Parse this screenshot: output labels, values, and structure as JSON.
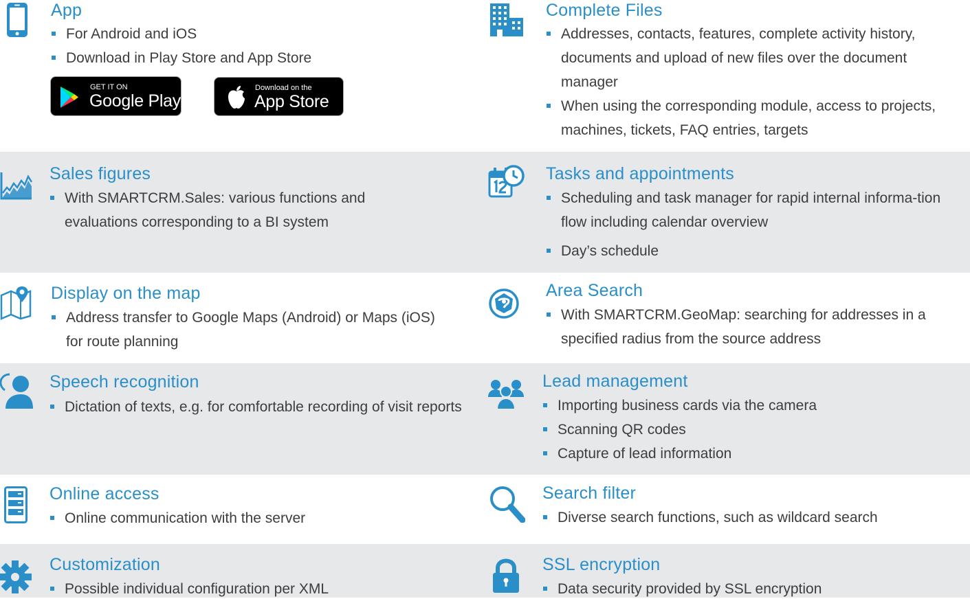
{
  "colors": {
    "accent": "#2a8fc9",
    "band_grey": "#e7e8ea",
    "text": "#3d3d3d"
  },
  "left": [
    {
      "title": "App",
      "icon": "smartphone-icon",
      "bullets": [
        "For Android and iOS",
        "Download in Play Store and App Store"
      ]
    },
    {
      "title": "Sales figures",
      "icon": "line-chart-icon",
      "bullets": [
        "With SMARTCRM.Sales: various functions and evaluations corresponding to a BI system"
      ]
    },
    {
      "title": "Display on the map",
      "icon": "map-pin-icon",
      "bullets": [
        "Address transfer to Google Maps (Android) or Maps (iOS) for route planning"
      ]
    },
    {
      "title": "Speech recognition",
      "icon": "speaking-person-icon",
      "bullets": [
        "Dictation of texts, e.g. for comfortable recording of visit reports"
      ]
    },
    {
      "title": "Online access",
      "icon": "server-icon",
      "bullets": [
        "Online communication with the server"
      ]
    },
    {
      "title": "Customization",
      "icon": "gear-icon",
      "bullets": [
        "Possible individual configuration per XML"
      ]
    }
  ],
  "right": [
    {
      "title": "Complete Files",
      "icon": "office-building-icon",
      "bullets": [
        "Addresses, contacts, features, complete activity history, documents and upload of new files over the document manager",
        "When using the corresponding module, access to projects, machines, tickets, FAQ entries, targets"
      ]
    },
    {
      "title": "Tasks and appointments",
      "icon": "calendar-clock-icon",
      "bullets": [
        "Scheduling and task manager for rapid internal informa-tion flow including calendar overview",
        "Day’s schedule"
      ]
    },
    {
      "title": "Area Search",
      "icon": "radius-search-icon",
      "bullets": [
        "With SMARTCRM.GeoMap: searching for addresses in a specified radius from the source address"
      ]
    },
    {
      "title": "Lead management",
      "icon": "people-group-icon",
      "bullets": [
        "Importing business cards via the camera",
        "Scanning QR codes",
        "Capture of lead information"
      ]
    },
    {
      "title": "Search filter",
      "icon": "magnifier-icon",
      "bullets": [
        "Diverse search functions, such as wildcard search"
      ]
    },
    {
      "title": "SSL encryption",
      "icon": "padlock-icon",
      "bullets": [
        "Data security provided by SSL encryption"
      ]
    }
  ],
  "badges": {
    "google_play": {
      "small": "GET IT ON",
      "big": "Google Play"
    },
    "app_store": {
      "small": "Download on the",
      "big": "App Store"
    }
  }
}
